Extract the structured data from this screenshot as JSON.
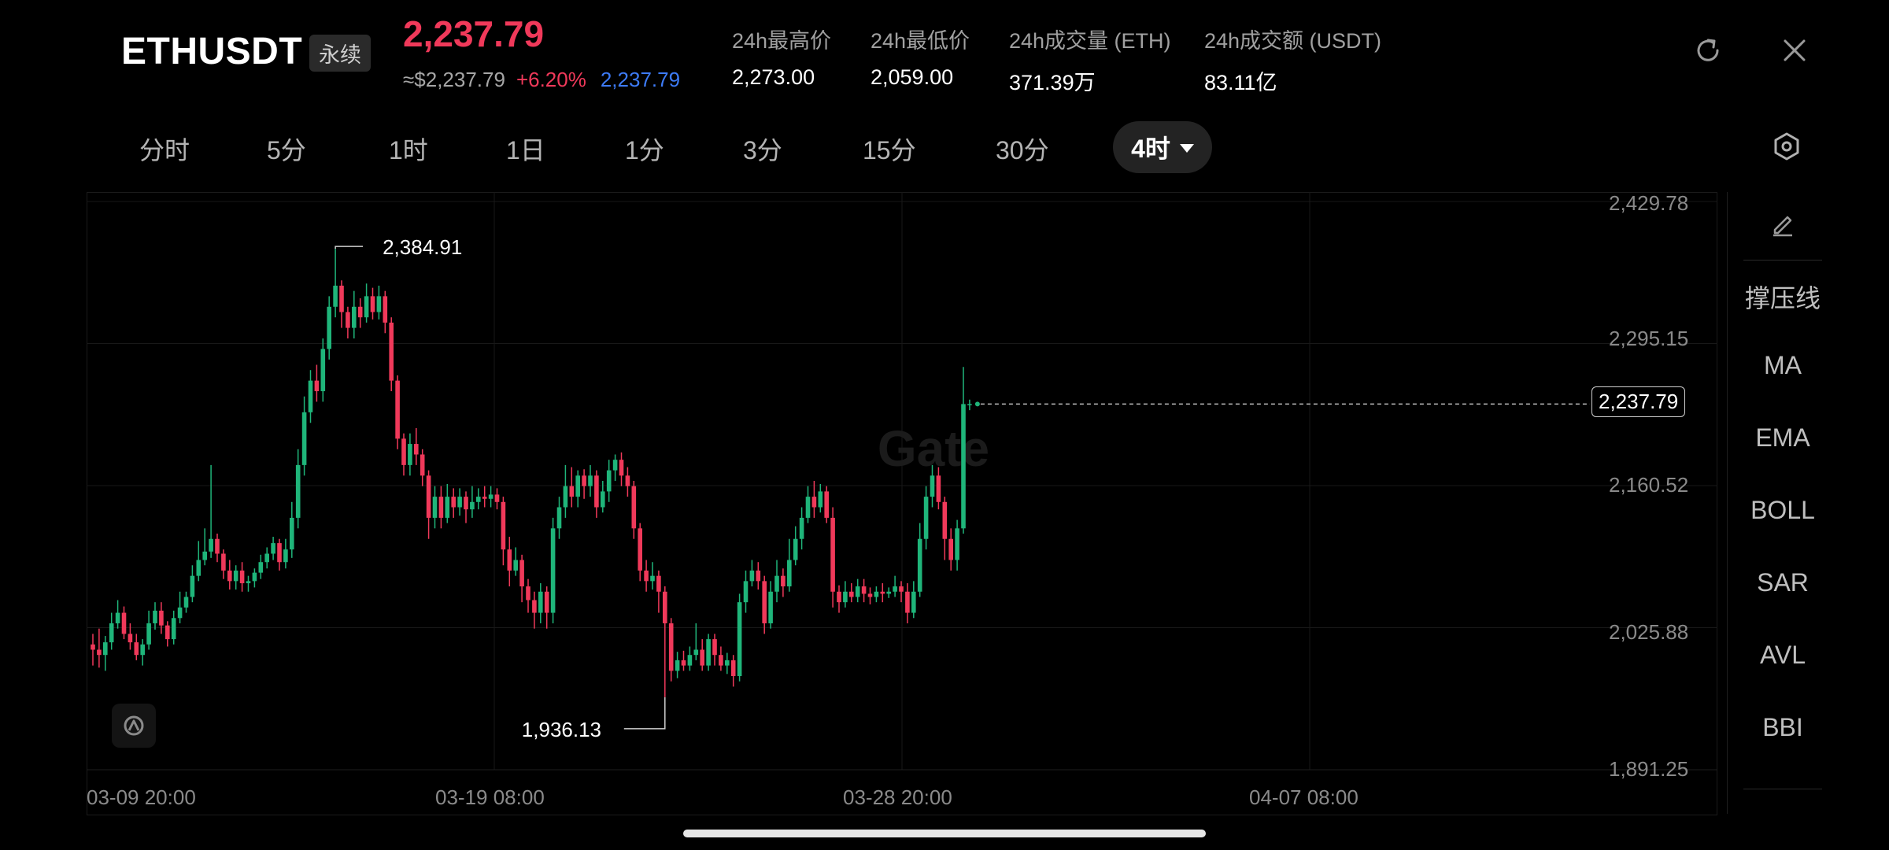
{
  "header": {
    "symbol": "ETHUSDT",
    "contract_type": "永续",
    "last_price": "2,237.79",
    "index_price": "≈$2,237.79",
    "change_pct": "+6.20%",
    "mark_price": "2,237.79",
    "stats": [
      {
        "label": "24h最高价",
        "value": "2,273.00"
      },
      {
        "label": "24h最低价",
        "value": "2,059.00"
      },
      {
        "label": "24h成交量 (ETH)",
        "value": "371.39万"
      },
      {
        "label": "24h成交额 (USDT)",
        "value": "83.11亿"
      }
    ],
    "icons": [
      "refresh-icon",
      "close-icon"
    ]
  },
  "intervals": {
    "tabs": [
      "分时",
      "5分",
      "1时",
      "1日",
      "1分",
      "3分",
      "15分",
      "30分"
    ],
    "active": "4时",
    "settings_icon": "hexagon-settings-icon"
  },
  "chart": {
    "watermark": "Gate",
    "y_ticks": [
      "2,429.78",
      "2,295.15",
      "2,160.52",
      "2,025.88",
      "1,891.25"
    ],
    "x_ticks": [
      "03-09 20:00",
      "03-19 08:00",
      "03-28 20:00",
      "04-07 08:00"
    ],
    "high_marker": "2,384.91",
    "low_marker": "1,936.13",
    "current_price_tag": "2,237.79",
    "colors": {
      "up": "#1fb57a",
      "down": "#f0395a",
      "mark": "#3d7bf7",
      "background": "#000000"
    }
  },
  "indicator_panel": {
    "edit_icon": "pencil-icon",
    "items": [
      "撑压线",
      "MA",
      "EMA",
      "BOLL",
      "SAR",
      "AVL",
      "BBI"
    ]
  },
  "chart_data": {
    "type": "candlestick",
    "interval": "4h",
    "ylim": [
      1891.25,
      2429.78
    ],
    "x_ticks": [
      "03-09 20:00",
      "03-19 08:00",
      "03-28 20:00",
      "04-07 08:00"
    ],
    "y_ticks": [
      2429.78,
      2295.15,
      2160.52,
      2025.88,
      1891.25
    ],
    "candles": [
      [
        2010,
        2005,
        2020,
        1990
      ],
      [
        2005,
        2000,
        2025,
        1988
      ],
      [
        2000,
        2012,
        2018,
        1985
      ],
      [
        2012,
        2030,
        2040,
        2005
      ],
      [
        2030,
        2040,
        2052,
        2025
      ],
      [
        2040,
        2020,
        2046,
        2015
      ],
      [
        2020,
        2012,
        2030,
        2005
      ],
      [
        2012,
        2000,
        2020,
        1995
      ],
      [
        2000,
        2010,
        2015,
        1990
      ],
      [
        2010,
        2030,
        2042,
        2005
      ],
      [
        2030,
        2042,
        2050,
        2024
      ],
      [
        2042,
        2028,
        2050,
        2020
      ],
      [
        2028,
        2015,
        2032,
        2008
      ],
      [
        2015,
        2035,
        2042,
        2010
      ],
      [
        2035,
        2045,
        2060,
        2030
      ],
      [
        2045,
        2055,
        2060,
        2040
      ],
      [
        2055,
        2075,
        2085,
        2050
      ],
      [
        2075,
        2090,
        2108,
        2070
      ],
      [
        2090,
        2098,
        2120,
        2085
      ],
      [
        2098,
        2110,
        2180,
        2092
      ],
      [
        2110,
        2096,
        2115,
        2088
      ],
      [
        2096,
        2080,
        2100,
        2072
      ],
      [
        2080,
        2070,
        2090,
        2062
      ],
      [
        2070,
        2080,
        2085,
        2062
      ],
      [
        2080,
        2068,
        2088,
        2060
      ],
      [
        2068,
        2070,
        2075,
        2060
      ],
      [
        2070,
        2078,
        2082,
        2064
      ],
      [
        2078,
        2088,
        2095,
        2072
      ],
      [
        2088,
        2096,
        2102,
        2082
      ],
      [
        2096,
        2106,
        2112,
        2090
      ],
      [
        2106,
        2088,
        2110,
        2080
      ],
      [
        2088,
        2100,
        2110,
        2082
      ],
      [
        2100,
        2130,
        2145,
        2092
      ],
      [
        2130,
        2180,
        2195,
        2120
      ],
      [
        2180,
        2230,
        2245,
        2170
      ],
      [
        2230,
        2260,
        2270,
        2220
      ],
      [
        2260,
        2250,
        2275,
        2240
      ],
      [
        2250,
        2290,
        2300,
        2240
      ],
      [
        2290,
        2330,
        2340,
        2280
      ],
      [
        2330,
        2350,
        2384.91,
        2320
      ],
      [
        2350,
        2325,
        2355,
        2310
      ],
      [
        2325,
        2310,
        2330,
        2300
      ],
      [
        2310,
        2330,
        2345,
        2300
      ],
      [
        2330,
        2320,
        2338,
        2310
      ],
      [
        2320,
        2340,
        2352,
        2315
      ],
      [
        2340,
        2325,
        2348,
        2318
      ],
      [
        2325,
        2340,
        2350,
        2318
      ],
      [
        2340,
        2315,
        2345,
        2305
      ],
      [
        2315,
        2260,
        2320,
        2250
      ],
      [
        2260,
        2205,
        2265,
        2195
      ],
      [
        2205,
        2180,
        2210,
        2170
      ],
      [
        2180,
        2200,
        2210,
        2170
      ],
      [
        2200,
        2190,
        2215,
        2180
      ],
      [
        2190,
        2170,
        2195,
        2160
      ],
      [
        2170,
        2130,
        2175,
        2110
      ],
      [
        2130,
        2150,
        2160,
        2120
      ],
      [
        2150,
        2130,
        2160,
        2120
      ],
      [
        2130,
        2150,
        2162,
        2125
      ],
      [
        2150,
        2140,
        2158,
        2130
      ],
      [
        2140,
        2150,
        2158,
        2132
      ],
      [
        2150,
        2138,
        2155,
        2125
      ],
      [
        2138,
        2145,
        2160,
        2130
      ],
      [
        2145,
        2150,
        2158,
        2138
      ],
      [
        2150,
        2148,
        2160,
        2140
      ],
      [
        2148,
        2152,
        2160,
        2140
      ],
      [
        2152,
        2145,
        2158,
        2138
      ],
      [
        2145,
        2100,
        2150,
        2085
      ],
      [
        2100,
        2080,
        2112,
        2065
      ],
      [
        2080,
        2090,
        2102,
        2075
      ],
      [
        2090,
        2065,
        2095,
        2050
      ],
      [
        2065,
        2052,
        2072,
        2040
      ],
      [
        2052,
        2040,
        2060,
        2025
      ],
      [
        2040,
        2060,
        2068,
        2030
      ],
      [
        2060,
        2040,
        2065,
        2025
      ],
      [
        2040,
        2120,
        2130,
        2030
      ],
      [
        2120,
        2140,
        2150,
        2110
      ],
      [
        2140,
        2160,
        2180,
        2130
      ],
      [
        2160,
        2150,
        2178,
        2140
      ],
      [
        2150,
        2170,
        2175,
        2140
      ],
      [
        2170,
        2160,
        2176,
        2148
      ],
      [
        2160,
        2170,
        2180,
        2150
      ],
      [
        2170,
        2140,
        2175,
        2130
      ],
      [
        2140,
        2155,
        2165,
        2135
      ],
      [
        2155,
        2175,
        2185,
        2145
      ],
      [
        2175,
        2185,
        2190,
        2165
      ],
      [
        2185,
        2170,
        2192,
        2160
      ],
      [
        2170,
        2160,
        2178,
        2150
      ],
      [
        2160,
        2120,
        2165,
        2110
      ],
      [
        2120,
        2080,
        2125,
        2070
      ],
      [
        2080,
        2070,
        2090,
        2060
      ],
      [
        2070,
        2075,
        2088,
        2062
      ],
      [
        2075,
        2060,
        2080,
        2040
      ],
      [
        2060,
        2030,
        2065,
        1960
      ],
      [
        2030,
        1985,
        2035,
        1975
      ],
      [
        1985,
        1995,
        2003,
        1978
      ],
      [
        1995,
        1990,
        2004,
        1985
      ],
      [
        1990,
        2000,
        2008,
        1985
      ],
      [
        2000,
        2005,
        2030,
        1995
      ],
      [
        2005,
        1990,
        2015,
        1985
      ],
      [
        1990,
        2015,
        2020,
        1985
      ],
      [
        2015,
        2000,
        2020,
        1990
      ],
      [
        2000,
        1990,
        2008,
        1985
      ],
      [
        1990,
        1995,
        2002,
        1982
      ],
      [
        1995,
        1980,
        2000,
        1970
      ],
      [
        1980,
        2050,
        2058,
        1975
      ],
      [
        2050,
        2070,
        2080,
        2040
      ],
      [
        2070,
        2080,
        2090,
        2065
      ],
      [
        2080,
        2070,
        2088,
        2062
      ],
      [
        2070,
        2030,
        2075,
        2020
      ],
      [
        2030,
        2060,
        2070,
        2025
      ],
      [
        2060,
        2075,
        2090,
        2050
      ],
      [
        2075,
        2065,
        2082,
        2055
      ],
      [
        2065,
        2090,
        2110,
        2060
      ],
      [
        2090,
        2110,
        2122,
        2085
      ],
      [
        2110,
        2130,
        2140,
        2100
      ],
      [
        2130,
        2150,
        2160,
        2125
      ],
      [
        2150,
        2140,
        2165,
        2130
      ],
      [
        2140,
        2155,
        2162,
        2135
      ],
      [
        2155,
        2130,
        2160,
        2125
      ],
      [
        2130,
        2060,
        2140,
        2045
      ],
      [
        2060,
        2050,
        2066,
        2040
      ],
      [
        2050,
        2060,
        2070,
        2045
      ],
      [
        2060,
        2055,
        2068,
        2050
      ],
      [
        2055,
        2065,
        2072,
        2050
      ],
      [
        2065,
        2058,
        2072,
        2050
      ],
      [
        2058,
        2055,
        2064,
        2048
      ],
      [
        2055,
        2060,
        2065,
        2050
      ],
      [
        2060,
        2058,
        2068,
        2050
      ],
      [
        2058,
        2060,
        2064,
        2054
      ],
      [
        2060,
        2065,
        2075,
        2055
      ],
      [
        2065,
        2060,
        2070,
        2050
      ],
      [
        2060,
        2040,
        2068,
        2030
      ],
      [
        2040,
        2060,
        2070,
        2035
      ],
      [
        2060,
        2110,
        2125,
        2055
      ],
      [
        2110,
        2150,
        2160,
        2100
      ],
      [
        2150,
        2170,
        2180,
        2140
      ],
      [
        2170,
        2145,
        2178,
        2138
      ],
      [
        2145,
        2110,
        2150,
        2090
      ],
      [
        2110,
        2090,
        2120,
        2080
      ],
      [
        2090,
        2120,
        2128,
        2080
      ],
      [
        2120,
        2237.79,
        2273,
        2115
      ],
      [
        2237.79,
        2237.79,
        2242,
        2232
      ]
    ]
  }
}
